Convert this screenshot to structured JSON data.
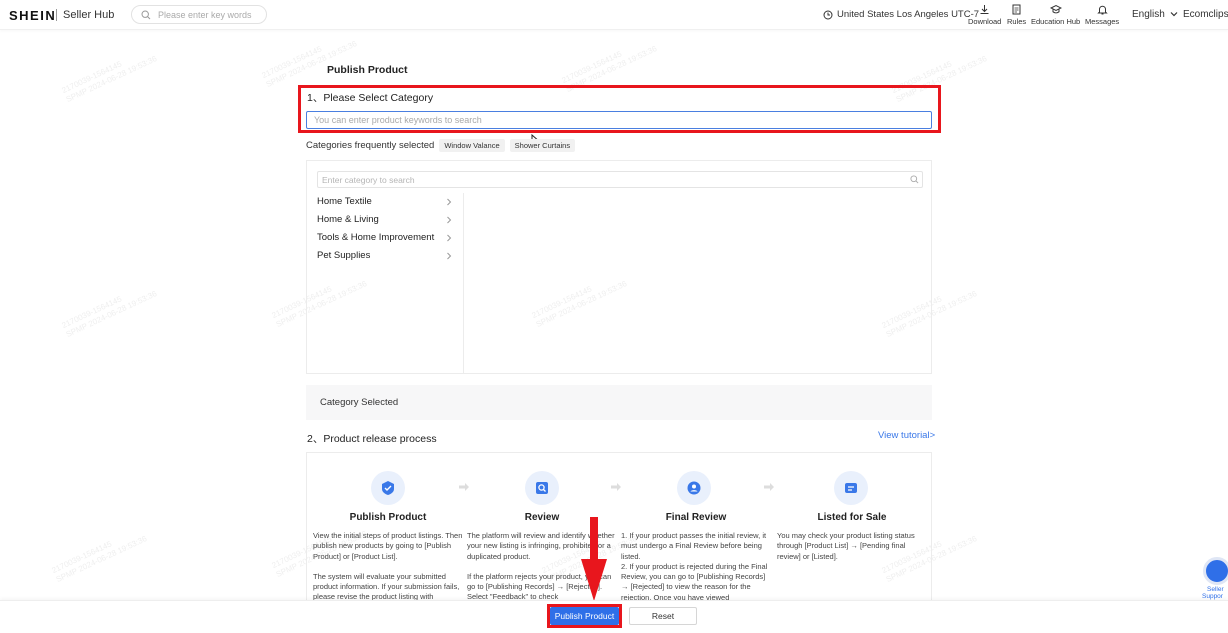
{
  "header": {
    "logo": "SHEIN",
    "logo_sub": "Seller Hub",
    "search_placeholder": "Please enter key words",
    "timezone": "United States Los Angeles UTC-7",
    "tools": [
      "Download",
      "Rules",
      "Education Hub",
      "Messages"
    ],
    "language": "English",
    "account": "Ecomclips"
  },
  "watermark": {
    "line1": "2170039-1564145",
    "line2": "SPMP 2024-06-28 19:53:36"
  },
  "page": {
    "title": "Publish Product",
    "section1_title": "1、Please Select Category",
    "keyword_placeholder": "You can enter product keywords to search",
    "frequent_label": "Categories frequently selected",
    "frequent_chips": [
      "Window Valance",
      "Shower Curtains"
    ],
    "category_search_placeholder": "Enter category to search",
    "categories": [
      "Home Textile",
      "Home & Living",
      "Tools & Home Improvement",
      "Pet Supplies"
    ],
    "category_selected_label": "Category Selected",
    "section2_title": "2、Product release process",
    "view_tutorial": "View tutorial>"
  },
  "steps": [
    {
      "title": "Publish Product",
      "p1": "View the initial steps of product listings. Then publish new products by going to [Publish Product] or [Product List].",
      "p2": "The system will evaluate your submitted product information. If your submission fails, please revise the product listing with"
    },
    {
      "title": "Review",
      "p1": "The platform will review and identify whether your new listing is infringing, prohibited or a duplicated product.",
      "p2": "If the platform rejects your product, you can go to [Publishing Records] → [Rejected]. Select \"Feedback\" to check"
    },
    {
      "title": "Final Review",
      "p1": "1. If your product passes the initial review, it must undergo a Final Review before being listed.",
      "p2": "2. If your product is rejected during the Final Review, you can go to [Publishing Records] → [Rejected] to view the reason for the rejection. Once you have viewed"
    },
    {
      "title": "Listed for Sale",
      "p1": "You may check your product listing status through [Product List] → [Pending final review] or [Listed].",
      "p2": ""
    }
  ],
  "footer": {
    "publish_label": "Publish Product",
    "reset_label": "Reset"
  },
  "support": {
    "label_line1": "Seller",
    "label_line2": "Suppor"
  },
  "colors": {
    "primary": "#2f6fe8",
    "highlight_red": "#e8161d",
    "link": "#3a78e8",
    "icon_bg": "#e9f0fc"
  }
}
